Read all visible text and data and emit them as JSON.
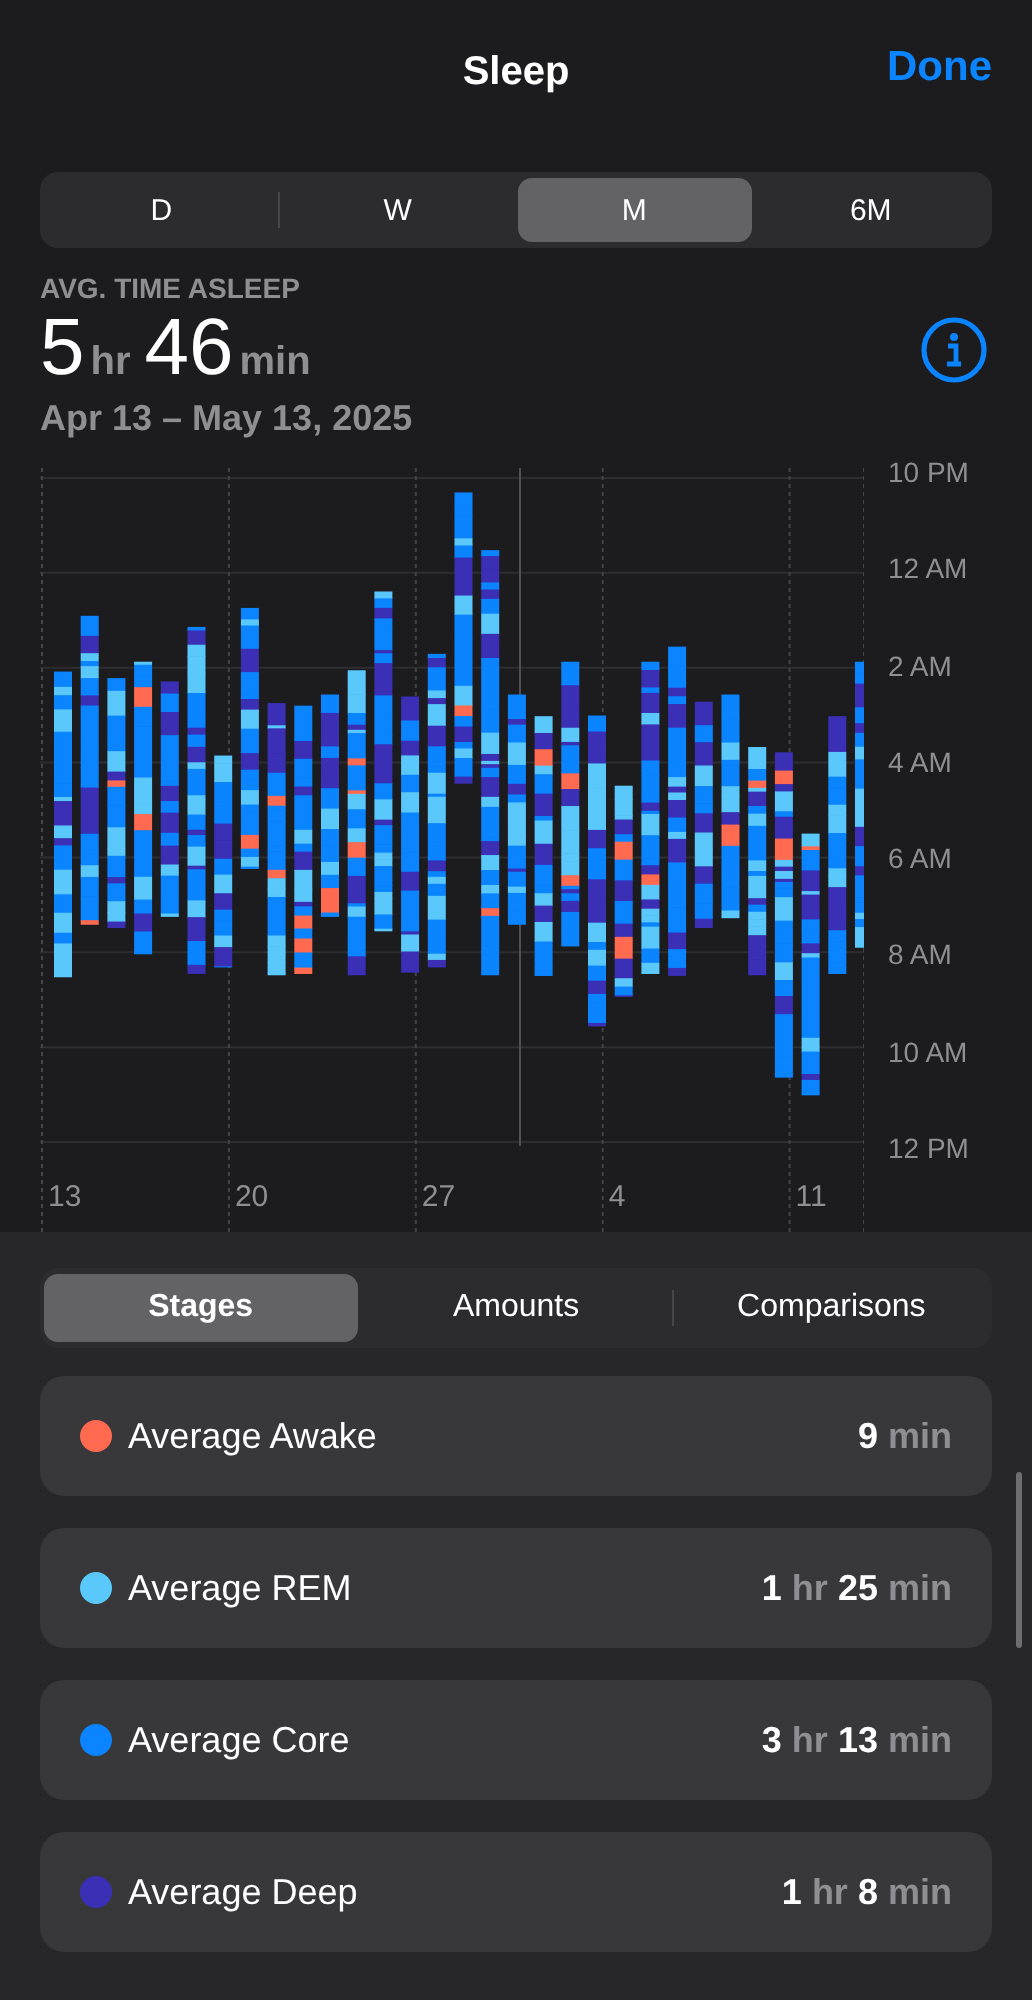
{
  "nav": {
    "title": "Sleep",
    "done": "Done"
  },
  "ranges": [
    {
      "label": "D",
      "selected": false
    },
    {
      "label": "W",
      "selected": false
    },
    {
      "label": "M",
      "selected": true
    },
    {
      "label": "6M",
      "selected": false
    }
  ],
  "summary": {
    "label": "AVG. TIME ASLEEP",
    "hours": "5",
    "hours_unit": "hr",
    "minutes": "46",
    "minutes_unit": "min",
    "date_range": "Apr 13 – May 13, 2025"
  },
  "chart": {
    "y_labels": [
      "10 PM",
      "12 AM",
      "2 AM",
      "4 AM",
      "6 AM",
      "8 AM",
      "10 AM",
      "12 PM"
    ],
    "x_labels": [
      "13",
      "20",
      "27",
      "4",
      "11"
    ]
  },
  "views": [
    {
      "label": "Stages",
      "selected": true
    },
    {
      "label": "Amounts",
      "selected": false
    },
    {
      "label": "Comparisons",
      "selected": false
    }
  ],
  "stages": [
    {
      "label": "Average Awake",
      "color": "#ff6a50",
      "value": [
        {
          "n": "9"
        },
        {
          "u": "min"
        }
      ]
    },
    {
      "label": "Average REM",
      "color": "#5ac8fa",
      "value": [
        {
          "n": "1"
        },
        {
          "u": "hr"
        },
        {
          "n": "25"
        },
        {
          "u": "min"
        }
      ]
    },
    {
      "label": "Average Core",
      "color": "#0a84ff",
      "value": [
        {
          "n": "3"
        },
        {
          "u": "hr"
        },
        {
          "n": "13"
        },
        {
          "u": "min"
        }
      ]
    },
    {
      "label": "Average Deep",
      "color": "#3a2fb5",
      "value": [
        {
          "n": "1"
        },
        {
          "u": "hr"
        },
        {
          "n": "8"
        },
        {
          "u": "min"
        }
      ]
    }
  ]
}
